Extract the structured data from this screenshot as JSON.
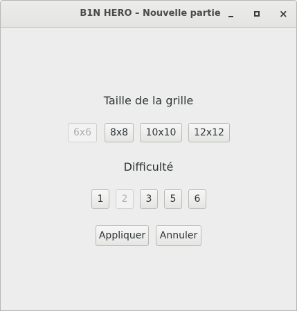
{
  "window": {
    "title": "B1N HERO – Nouvelle partie",
    "controls": {
      "minimize": "minimize-icon",
      "maximize": "maximize-icon",
      "close": "close-icon",
      "close_glyph": "×"
    }
  },
  "grid_size": {
    "heading": "Taille de la grille",
    "options": [
      {
        "label": "6x6",
        "disabled": true
      },
      {
        "label": "8x8",
        "disabled": false
      },
      {
        "label": "10x10",
        "disabled": false
      },
      {
        "label": "12x12",
        "disabled": false
      }
    ]
  },
  "difficulty": {
    "heading": "Difficulté",
    "options": [
      {
        "label": "1",
        "disabled": false
      },
      {
        "label": "2",
        "disabled": true
      },
      {
        "label": "3",
        "disabled": false
      },
      {
        "label": "5",
        "disabled": false
      },
      {
        "label": "6",
        "disabled": false
      }
    ]
  },
  "actions": {
    "apply_label": "Appliquer",
    "cancel_label": "Annuler"
  },
  "colors": {
    "window_background": "#ededed",
    "text": "#2e3436",
    "disabled_text": "#aeaeae"
  }
}
